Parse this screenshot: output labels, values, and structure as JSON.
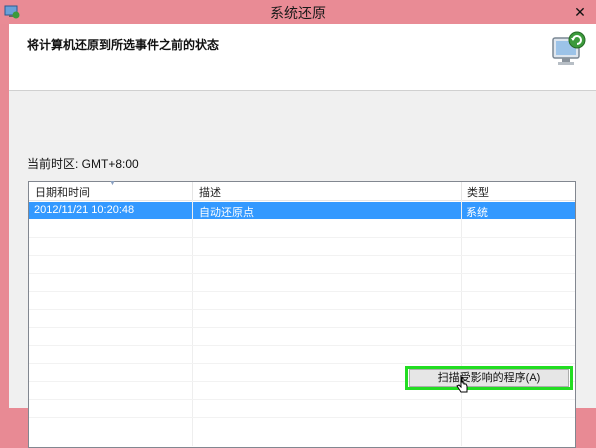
{
  "window": {
    "title": "系统还原",
    "close_glyph": "✕",
    "app_icon": "system-restore-icon"
  },
  "header": {
    "heading": "将计算机还原到所选事件之前的状态",
    "icon": "computer-restore-icon"
  },
  "timezone_label": "当前时区: GMT+8:00",
  "table": {
    "columns": [
      "日期和时间",
      "描述",
      "类型"
    ],
    "rows": [
      {
        "date": "2012/11/21 10:20:48",
        "description": "自动还原点",
        "type": "系统",
        "selected": true
      }
    ]
  },
  "scan_button": {
    "label": "扫描受影响的程序(A)",
    "highlight_color": "#22dd22"
  },
  "colors": {
    "titlebar": "#e98b95",
    "selection": "#3399ff"
  }
}
